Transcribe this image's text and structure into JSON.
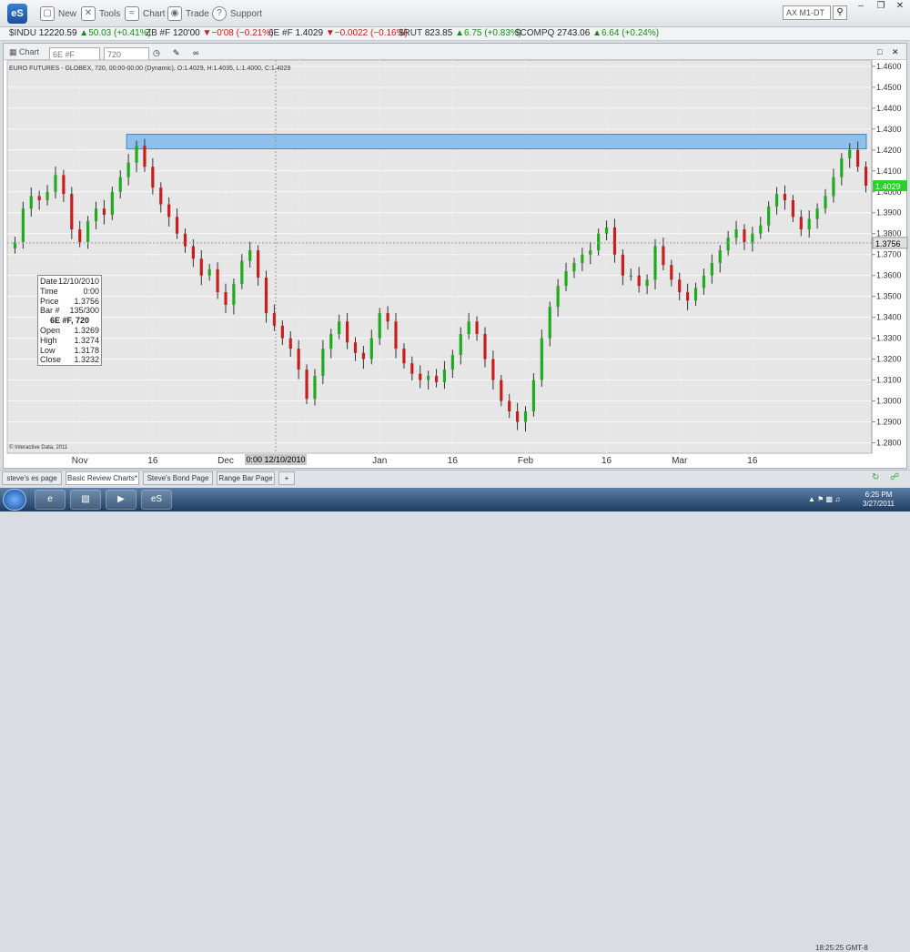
{
  "toolbar": {
    "logo": "eS",
    "new_label": "New",
    "tools_label": "Tools",
    "chart_label": "Chart",
    "trade_label": "Trade",
    "support_label": "Support",
    "symbol_value": "AX M1-DT"
  },
  "ticker": [
    {
      "symbol": "$INDU",
      "price": "12220.59",
      "change": "50.03 (+0.41%)",
      "dir": "up"
    },
    {
      "symbol": "ZB #F",
      "price": "120'00",
      "change": "−0'08 (−0.21%)",
      "dir": "down"
    },
    {
      "symbol": "6E #F",
      "price": "1.4029",
      "change": "−0.0022 (−0.16%)",
      "dir": "down"
    },
    {
      "symbol": "$RUT",
      "price": "823.85",
      "change": "6.75 (+0.83%)",
      "dir": "up"
    },
    {
      "symbol": "$COMPQ",
      "price": "2743.06",
      "change": "6.64 (+0.24%)",
      "dir": "up"
    }
  ],
  "chartwin": {
    "title_label": "Chart",
    "symbol": "6E #F",
    "interval": "720"
  },
  "chart_header": "EURO FUTURES - GLOBEX, 720, 00:00-00:00 (Dynamic), O:1.4029, H:1.4035, L:1.4000, C:1.4029",
  "copyright": "© Interactive Data, 2011",
  "infobox": {
    "date_label": "Date",
    "date": "12/10/2010",
    "time_label": "Time",
    "time": "0:00",
    "price_label": "Price",
    "price": "1.3756",
    "bar_label": "Bar #",
    "bar": "135/300",
    "symbol_header": "6E #F, 720",
    "open_label": "Open",
    "open": "1.3269",
    "high_label": "High",
    "high": "1.3274",
    "low_label": "Low",
    "low": "1.3178",
    "close_label": "Close",
    "close": "1.3232"
  },
  "tabs": [
    "steve's es page",
    "Basic Review Charts*",
    "Steve's Bond Page",
    "Range Bar Page",
    "+"
  ],
  "status_time": "18:25:25 GMT-8",
  "clock": {
    "time": "6:25 PM",
    "date": "3/27/2011"
  },
  "colors": {
    "up": "#1faa1f",
    "down": "#c81e1e",
    "zone": "#7fb8ec",
    "last": "#2bd12b"
  },
  "chart_data": {
    "type": "candlestick",
    "x_ticks": [
      "Nov",
      "16",
      "Dec",
      "16",
      "Jan",
      "16",
      "Feb",
      "16",
      "Mar",
      "16"
    ],
    "y_ticks": [
      "1.4600",
      "1.4500",
      "1.4400",
      "1.4300",
      "1.4200",
      "1.4100",
      "1.4000",
      "1.3900",
      "1.3800",
      "1.3700",
      "1.3600",
      "1.3500",
      "1.3400",
      "1.3300",
      "1.3200",
      "1.3100",
      "1.3000",
      "1.2900",
      "1.2800"
    ],
    "ylim": [
      1.275,
      1.463
    ],
    "crosshair_price": "1.3756",
    "crosshair_time": "0:00 12/10/2010",
    "last_price": "1.4029",
    "resistance_zone": [
      1.4205,
      1.4275
    ],
    "closes": [
      1.376,
      1.392,
      1.398,
      1.396,
      1.4,
      1.408,
      1.399,
      1.382,
      1.376,
      1.386,
      1.392,
      1.389,
      1.4,
      1.407,
      1.414,
      1.422,
      1.412,
      1.402,
      1.394,
      1.388,
      1.38,
      1.374,
      1.368,
      1.36,
      1.363,
      1.352,
      1.346,
      1.356,
      1.367,
      1.372,
      1.359,
      1.342,
      1.336,
      1.33,
      1.325,
      1.315,
      1.301,
      1.312,
      1.325,
      1.332,
      1.338,
      1.328,
      1.323,
      1.32,
      1.33,
      1.342,
      1.338,
      1.325,
      1.318,
      1.313,
      1.31,
      1.312,
      1.309,
      1.315,
      1.322,
      1.332,
      1.338,
      1.332,
      1.32,
      1.31,
      1.3,
      1.295,
      1.29,
      1.295,
      1.31,
      1.33,
      1.345,
      1.355,
      1.362,
      1.366,
      1.37,
      1.372,
      1.38,
      1.383,
      1.37,
      1.36,
      1.36,
      1.355,
      1.358,
      1.374,
      1.365,
      1.358,
      1.352,
      1.348,
      1.354,
      1.36,
      1.366,
      1.372,
      1.378,
      1.382,
      1.376,
      1.38,
      1.384,
      1.393,
      1.399,
      1.396,
      1.388,
      1.382,
      1.387,
      1.392,
      1.398,
      1.407,
      1.416,
      1.42,
      1.412,
      1.4029
    ]
  }
}
